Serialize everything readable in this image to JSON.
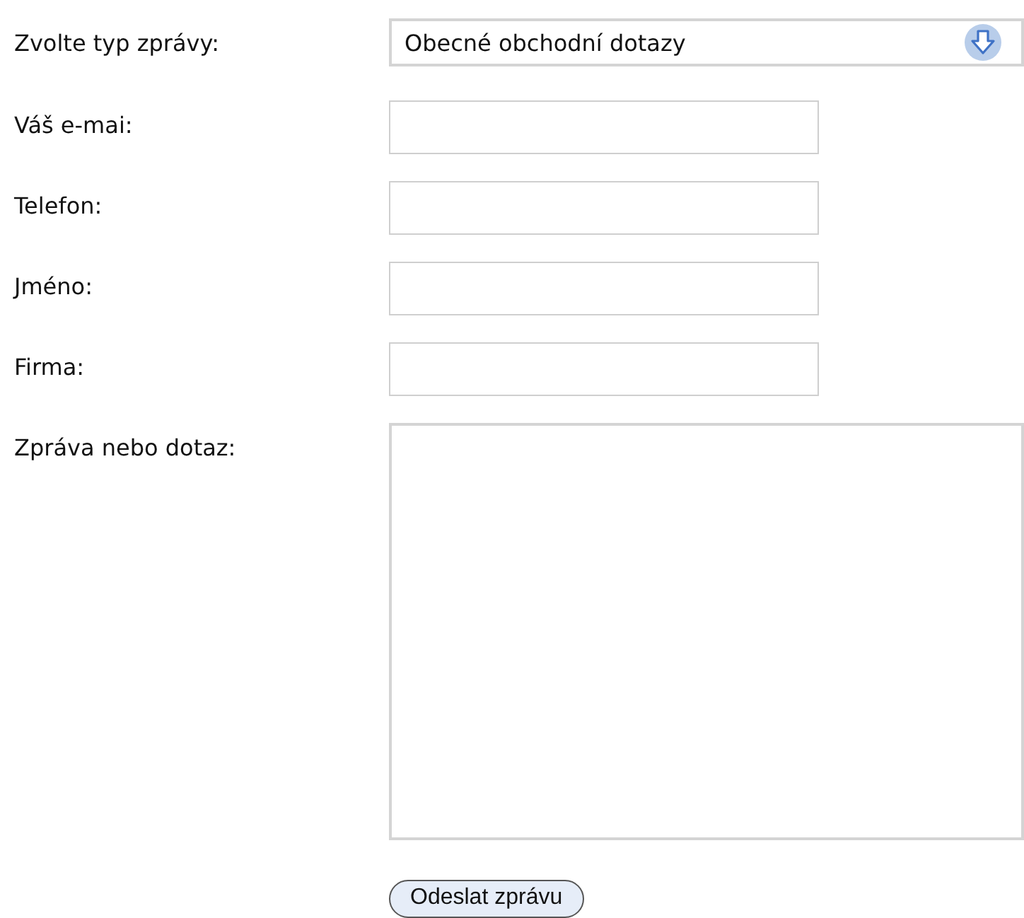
{
  "form": {
    "fields": [
      {
        "kind": "select",
        "label": "Zvolte typ zprávy:",
        "value": "Obecné obchodní dotazy"
      },
      {
        "kind": "text",
        "label": "Váš e-mai:"
      },
      {
        "kind": "text",
        "label": "Telefon:"
      },
      {
        "kind": "text",
        "label": "Jméno:"
      },
      {
        "kind": "text",
        "label": "Firma:"
      },
      {
        "kind": "textarea",
        "label": "Zpráva nebo dotaz:"
      }
    ],
    "submit": "Odeslat zprávu"
  }
}
